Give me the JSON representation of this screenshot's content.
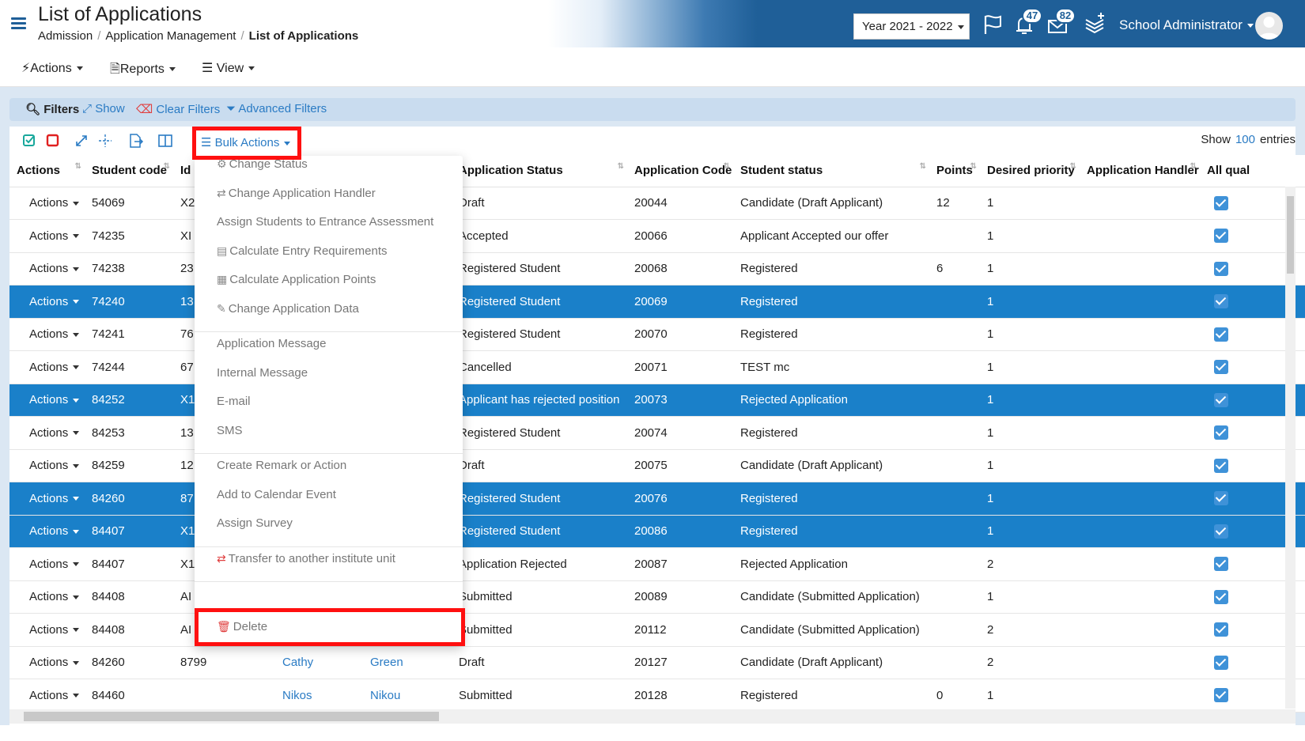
{
  "header": {
    "title": "List of Applications",
    "breadcrumb": [
      "Admission",
      "Application Management",
      "List of Applications"
    ],
    "year": "Year 2021 - 2022",
    "notifications_count": "47",
    "messages_count": "82",
    "user_name": "School Administrator"
  },
  "menubar": {
    "actions": "Actions",
    "reports": "Reports",
    "view": "View"
  },
  "filters": {
    "label": "Filters",
    "show": "Show",
    "clear": "Clear Filters",
    "advanced": "Advanced Filters"
  },
  "toolbar": {
    "bulk_actions": "Bulk Actions",
    "show_label": "Show",
    "entries_count": "100",
    "entries_label": "entries"
  },
  "table": {
    "columns": [
      "Actions",
      "Student code",
      "Id",
      "",
      "",
      "Application Status",
      "Application Code",
      "Student status",
      "Points",
      "Desired priority",
      "Application Handler",
      "All qual"
    ],
    "row_action_label": "Actions",
    "rows": [
      {
        "code": "54069",
        "id": "X2",
        "first": "",
        "last": "",
        "status": "Draft",
        "app_code": "20044",
        "student_status": "Candidate (Draft Applicant)",
        "points": "12",
        "priority": "1",
        "selected": false
      },
      {
        "code": "74235",
        "id": "XI",
        "first": "",
        "last": "",
        "status": "Accepted",
        "app_code": "20066",
        "student_status": "Applicant Accepted our offer",
        "points": "",
        "priority": "1",
        "selected": false
      },
      {
        "code": "74238",
        "id": "23",
        "first": "",
        "last": "",
        "status": "Registered Student",
        "app_code": "20068",
        "student_status": "Registered",
        "points": "6",
        "priority": "1",
        "selected": false
      },
      {
        "code": "74240",
        "id": "13",
        "first": "",
        "last": "",
        "status": "Registered Student",
        "app_code": "20069",
        "student_status": "Registered",
        "points": "",
        "priority": "1",
        "selected": true
      },
      {
        "code": "74241",
        "id": "76",
        "first": "",
        "last": "",
        "status": "Registered Student",
        "app_code": "20070",
        "student_status": "Registered",
        "points": "",
        "priority": "1",
        "selected": false
      },
      {
        "code": "74244",
        "id": "67",
        "first": "",
        "last": "",
        "status": "Cancelled",
        "app_code": "20071",
        "student_status": "TEST mc",
        "points": "",
        "priority": "1",
        "selected": false
      },
      {
        "code": "84252",
        "id": "X1",
        "first": "",
        "last": "",
        "status": "Applicant has rejected position",
        "app_code": "20073",
        "student_status": "Rejected Application",
        "points": "",
        "priority": "1",
        "selected": true
      },
      {
        "code": "84253",
        "id": "13",
        "first": "",
        "last": "",
        "status": "Registered Student",
        "app_code": "20074",
        "student_status": "Registered",
        "points": "",
        "priority": "1",
        "selected": false
      },
      {
        "code": "84259",
        "id": "12",
        "first": "",
        "last": "",
        "status": "Draft",
        "app_code": "20075",
        "student_status": "Candidate (Draft Applicant)",
        "points": "",
        "priority": "1",
        "selected": false
      },
      {
        "code": "84260",
        "id": "87",
        "first": "",
        "last": "",
        "status": "Registered Student",
        "app_code": "20076",
        "student_status": "Registered",
        "points": "",
        "priority": "1",
        "selected": true
      },
      {
        "code": "84407",
        "id": "X1",
        "first": "",
        "last": "",
        "status": "Registered Student",
        "app_code": "20086",
        "student_status": "Registered",
        "points": "",
        "priority": "1",
        "selected": true
      },
      {
        "code": "84407",
        "id": "X1",
        "first": "",
        "last": "",
        "status": "Application Rejected",
        "app_code": "20087",
        "student_status": "Rejected Application",
        "points": "",
        "priority": "2",
        "selected": false
      },
      {
        "code": "84408",
        "id": "AI",
        "first": "",
        "last": "",
        "status": "Submitted",
        "app_code": "20089",
        "student_status": "Candidate (Submitted Application)",
        "points": "",
        "priority": "1",
        "selected": false
      },
      {
        "code": "84408",
        "id": "AI",
        "first": "",
        "last": "",
        "status": "Submitted",
        "app_code": "20112",
        "student_status": "Candidate (Submitted Application)",
        "points": "",
        "priority": "2",
        "selected": false
      },
      {
        "code": "84260",
        "id": "8799",
        "first": "Cathy",
        "last": "Green",
        "status": "Draft",
        "app_code": "20127",
        "student_status": "Candidate (Draft Applicant)",
        "points": "",
        "priority": "2",
        "selected": false
      },
      {
        "code": "84460",
        "id": "",
        "first": "Nikos",
        "last": "Nikou",
        "status": "Submitted",
        "app_code": "20128",
        "student_status": "Registered",
        "points": "0",
        "priority": "1",
        "selected": false
      }
    ]
  },
  "bulk_menu": {
    "groups": [
      [
        {
          "label": "Change Status",
          "icon": "user-cog-icon"
        },
        {
          "label": "Change Application Handler",
          "icon": "exchange-icon"
        },
        {
          "label": "Assign Students to Entrance Assessment",
          "icon": ""
        },
        {
          "label": "Calculate Entry Requirements",
          "icon": "list-box-icon"
        },
        {
          "label": "Calculate Application Points",
          "icon": "calculator-icon"
        },
        {
          "label": "Change Application Data",
          "icon": "pencil-icon"
        }
      ],
      [
        {
          "label": "Application Message",
          "icon": ""
        },
        {
          "label": "Internal Message",
          "icon": ""
        },
        {
          "label": "E-mail",
          "icon": ""
        },
        {
          "label": "SMS",
          "icon": ""
        }
      ],
      [
        {
          "label": "Create Remark or Action",
          "icon": ""
        },
        {
          "label": "Add to Calendar Event",
          "icon": ""
        },
        {
          "label": "Assign Survey",
          "icon": ""
        }
      ],
      [
        {
          "label": "Transfer to another institute unit",
          "icon": "transfer-icon"
        }
      ]
    ],
    "delete": "Delete"
  },
  "colors": {
    "header_blue": "#1f5f98",
    "row_selected": "#1a80c9",
    "link": "#2a7bc4",
    "highlight_red": "#ff1010"
  }
}
